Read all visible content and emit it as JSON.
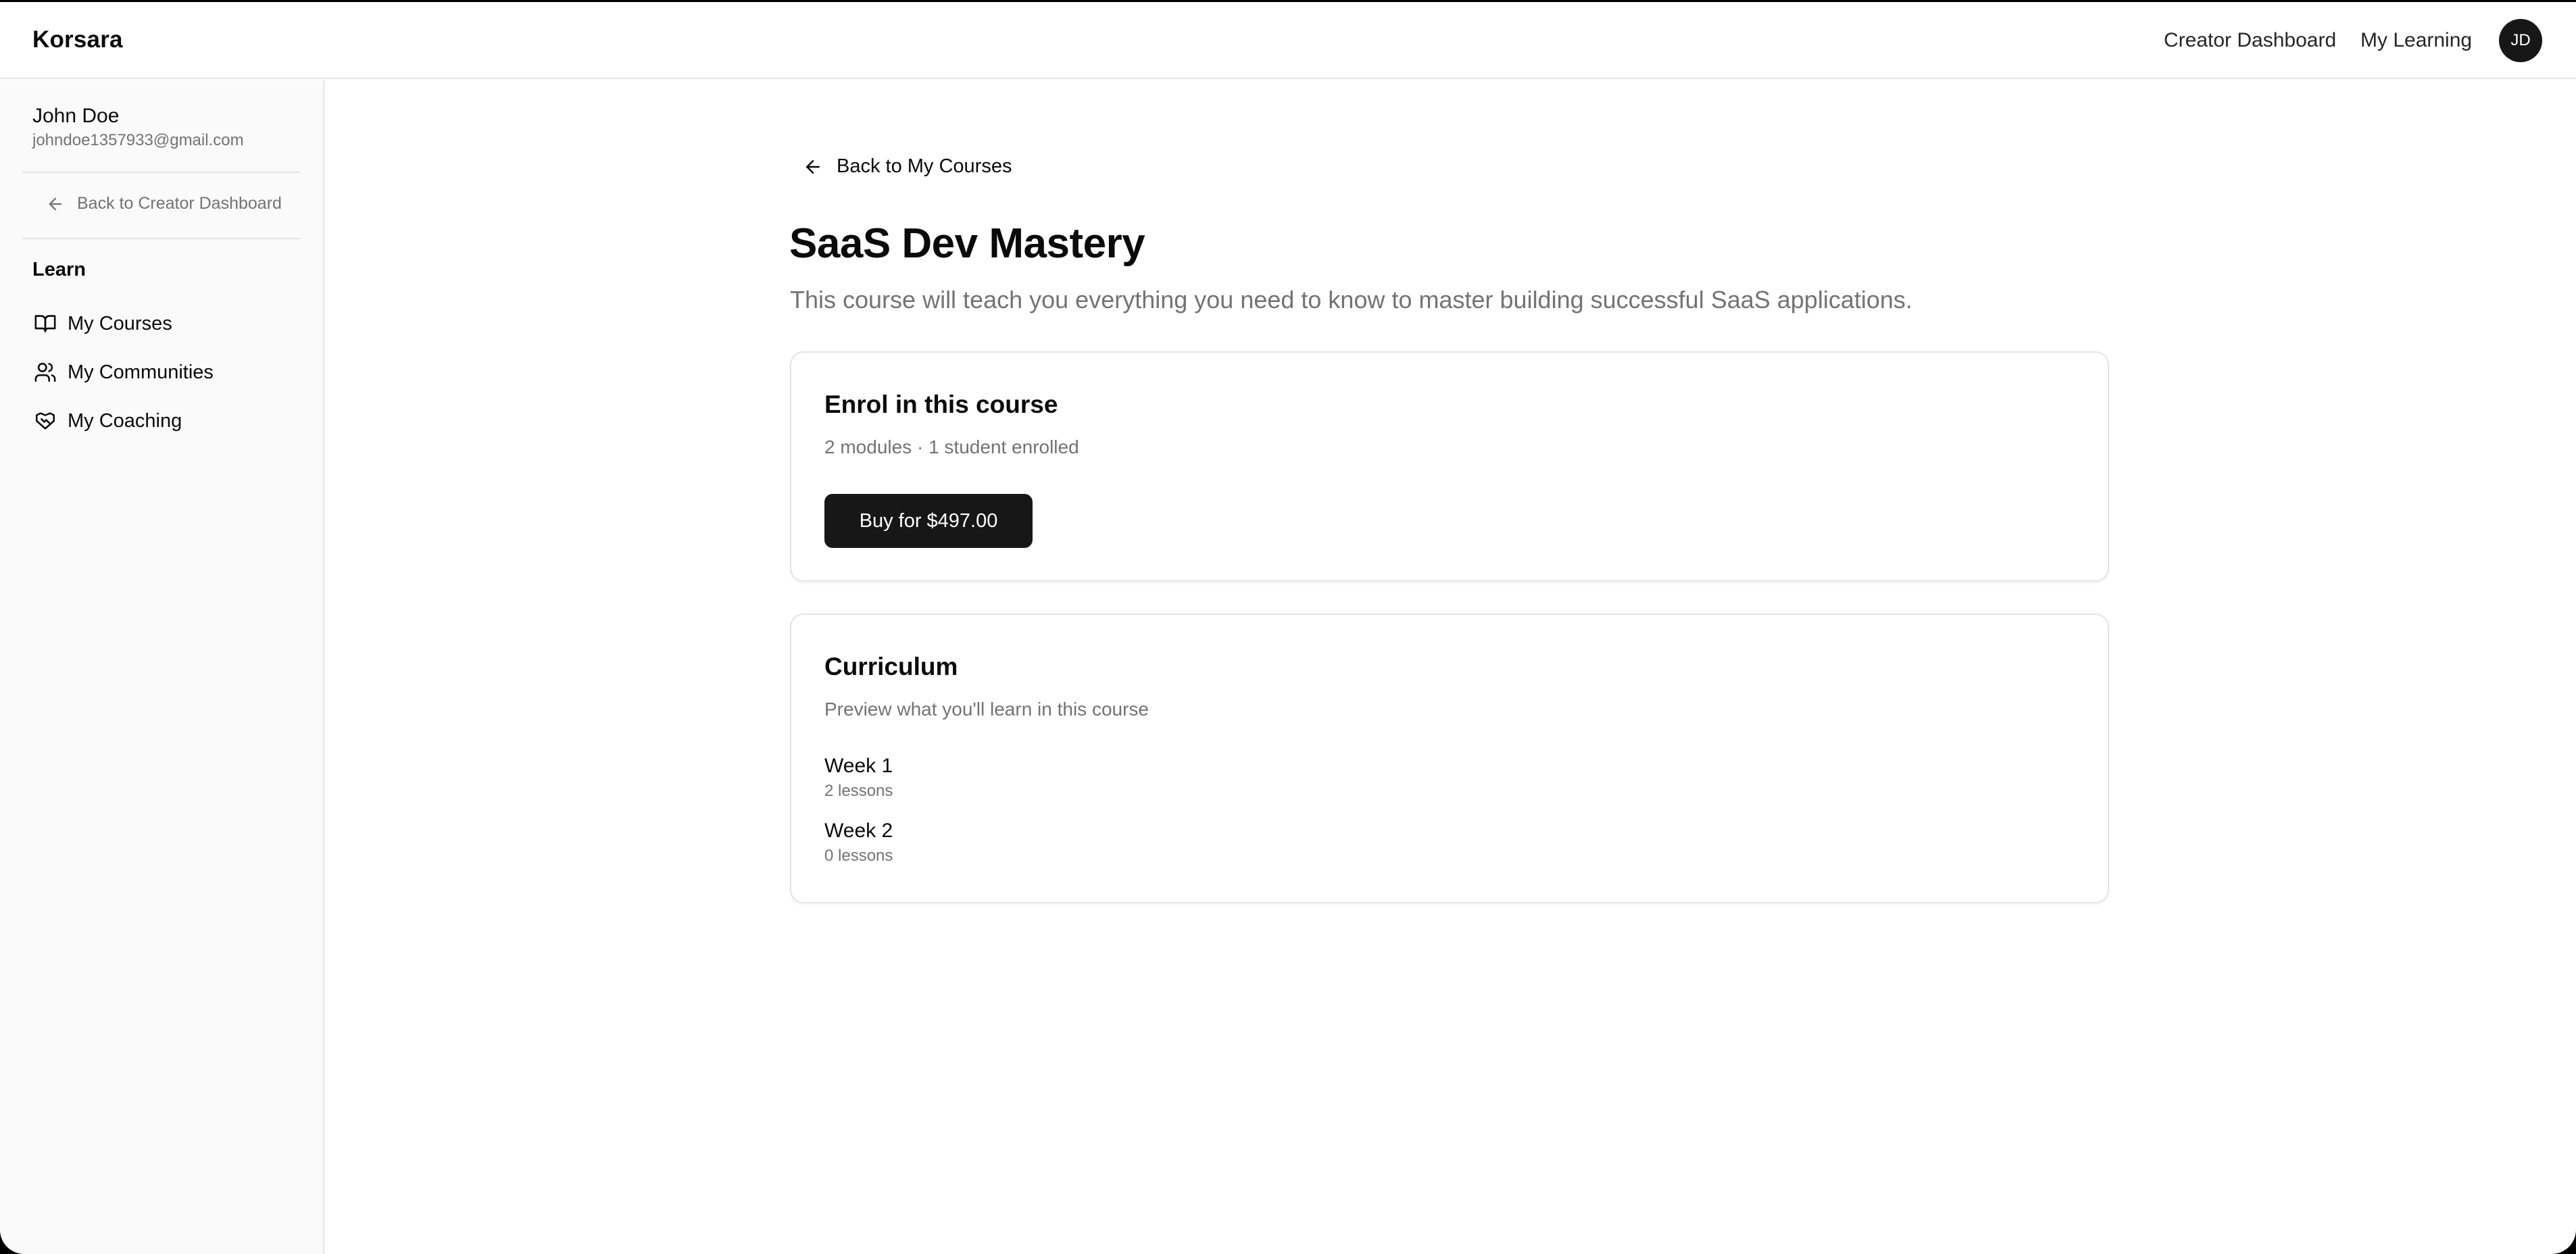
{
  "header": {
    "brand": "Korsara",
    "nav": {
      "creator_dashboard": "Creator Dashboard",
      "my_learning": "My Learning"
    },
    "avatar_initials": "JD"
  },
  "sidebar": {
    "user": {
      "name": "John Doe",
      "email": "johndoe1357933@gmail.com"
    },
    "back_label": "Back to Creator Dashboard",
    "section_label": "Learn",
    "items": [
      {
        "label": "My Courses",
        "icon": "book-open-icon"
      },
      {
        "label": "My Communities",
        "icon": "users-icon"
      },
      {
        "label": "My Coaching",
        "icon": "handshake-icon"
      }
    ]
  },
  "main": {
    "back_label": "Back to My Courses",
    "course": {
      "title": "SaaS Dev Mastery",
      "description": "This course will teach you everything you need to know to master building successful SaaS applications."
    },
    "enrol": {
      "title": "Enrol in this course",
      "meta": "2 modules · 1 student enrolled",
      "buy_label": "Buy for $497.00"
    },
    "curriculum": {
      "title": "Curriculum",
      "subtitle": "Preview what you'll learn in this course",
      "modules": [
        {
          "name": "Week 1",
          "lessons": "2 lessons"
        },
        {
          "name": "Week 2",
          "lessons": "0 lessons"
        }
      ]
    }
  },
  "colors": {
    "primary": "#171717",
    "muted_text": "#737373",
    "border": "#e5e5e5",
    "sidebar_bg": "#fafafa"
  }
}
